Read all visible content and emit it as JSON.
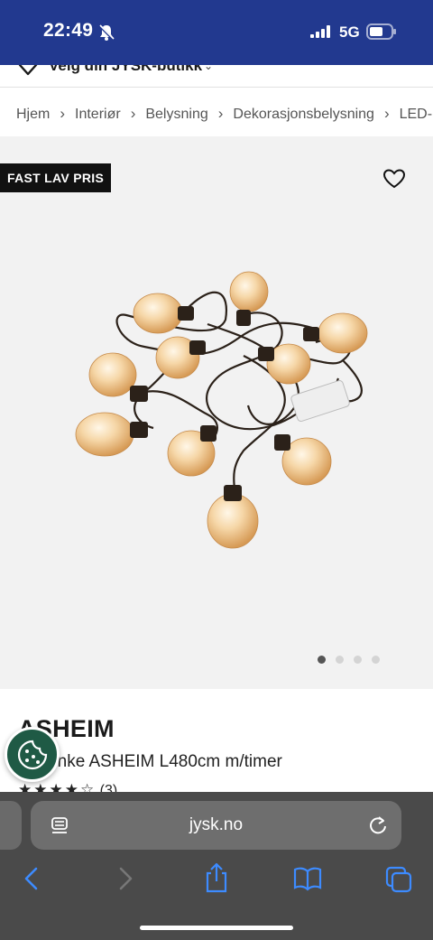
{
  "status_bar": {
    "time": "22:49",
    "network": "5G"
  },
  "store": {
    "label": "Velg din JYSK-butikk"
  },
  "breadcrumb": [
    "Hjem",
    "Interiør",
    "Belysning",
    "Dekorasjonsbelysning",
    "LED-l"
  ],
  "gallery": {
    "badge": "FAST LAV PRIS",
    "slide_count": 4,
    "active_slide": 1
  },
  "product": {
    "brand": "ASHEIM",
    "name": "Lyslenke ASHEIM L480cm m/timer",
    "rating": 4,
    "rating_max": 5,
    "review_count": "(3)"
  },
  "browser": {
    "url": "jysk.no"
  },
  "colors": {
    "brand_blue": "#22398f",
    "cookie_green": "#1f5a45",
    "badge_black": "#111111"
  },
  "icons": [
    "bell-slash-icon",
    "signal-icon",
    "battery-icon",
    "location-pin-icon",
    "heart-icon",
    "cookie-icon",
    "reader-icon",
    "reload-icon",
    "back-icon",
    "forward-icon",
    "share-icon",
    "bookmarks-icon",
    "tabs-icon"
  ]
}
